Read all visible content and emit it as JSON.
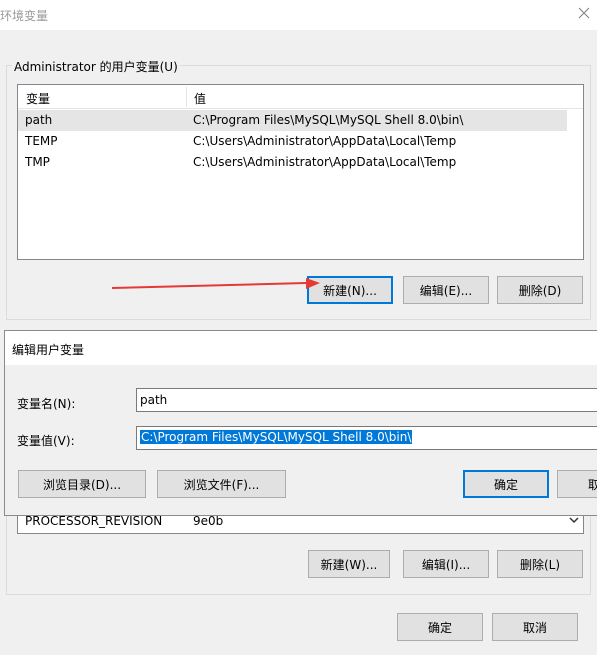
{
  "window": {
    "title": "环境变量"
  },
  "user_vars": {
    "group_label": "Administrator 的用户变量(U)",
    "columns": [
      "变量",
      "值"
    ],
    "rows": [
      {
        "name": "path",
        "value": "C:\\Program Files\\MySQL\\MySQL Shell 8.0\\bin\\"
      },
      {
        "name": "TEMP",
        "value": "C:\\Users\\Administrator\\AppData\\Local\\Temp"
      },
      {
        "name": "TMP",
        "value": "C:\\Users\\Administrator\\AppData\\Local\\Temp"
      }
    ],
    "selected_row": 0,
    "buttons": {
      "new": "新建(N)...",
      "edit": "编辑(E)...",
      "delete": "删除(D)"
    }
  },
  "edit_dialog": {
    "title": "编辑用户变量",
    "name_label": "变量名(N):",
    "name_value": "path",
    "value_label": "变量值(V):",
    "value_value": "C:\\Program Files\\MySQL\\MySQL Shell 8.0\\bin\\",
    "buttons": {
      "browse_dir": "浏览目录(D)...",
      "browse_file": "浏览文件(F)...",
      "ok": "确定",
      "cancel_partial": "取"
    }
  },
  "system_vars": {
    "visible_row": {
      "name": "PROCESSOR_REVISION",
      "value": "9e0b"
    },
    "buttons": {
      "new": "新建(W)...",
      "edit": "编辑(I)...",
      "delete": "删除(L)"
    }
  },
  "footer": {
    "ok": "确定",
    "cancel": "取消"
  },
  "colors": {
    "accent": "#0078d7",
    "arrow": "#e53935"
  }
}
